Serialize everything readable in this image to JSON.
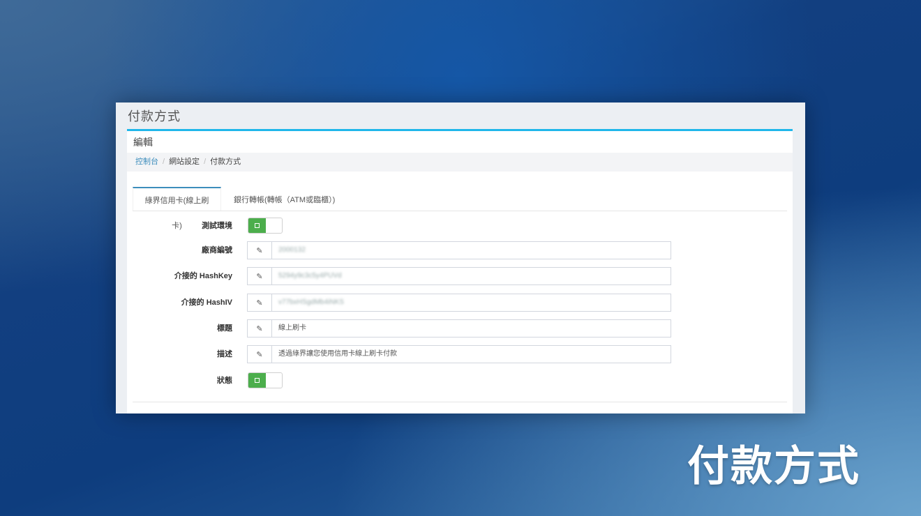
{
  "page": {
    "title": "付款方式"
  },
  "box": {
    "header": "編輯"
  },
  "breadcrumb": {
    "items": [
      "控制台",
      "網站設定",
      "付款方式"
    ]
  },
  "tabs": [
    "綠界信用卡(線上刷卡)",
    "銀行轉帳(轉帳（ATM或臨櫃）)"
  ],
  "form": {
    "test_env": {
      "label": "測試環境",
      "value": "on"
    },
    "merchant_id": {
      "label": "廠商編號",
      "value": "2000132",
      "icon": "pencil-icon"
    },
    "hash_key": {
      "label": "介接的 HashKey",
      "value": "5294y9c3c5y4PUVd",
      "icon": "pencil-icon"
    },
    "hash_iv": {
      "label": "介接的 HashIV",
      "value": "v77bxHSgdMb4iNKS",
      "icon": "pencil-icon"
    },
    "title": {
      "label": "標題",
      "value": "線上刷卡",
      "icon": "pencil-icon"
    },
    "description": {
      "label": "描述",
      "value": "透過綠界讓您使用信用卡線上刷卡付款",
      "icon": "pencil-icon"
    },
    "status": {
      "label": "狀態",
      "value": "on"
    }
  },
  "overlay_title": "付款方式",
  "colors": {
    "accent": "#20b7ea",
    "toggle_on": "#4cae4c",
    "link": "#3c8dbc"
  }
}
